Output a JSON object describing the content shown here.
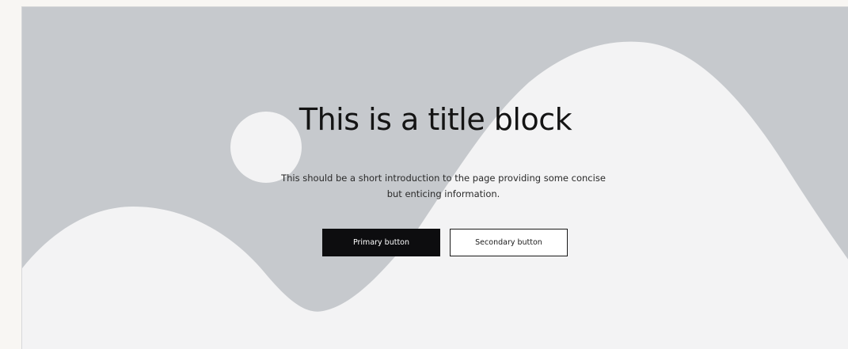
{
  "hero": {
    "title": "This is a title block",
    "intro": "This should be a short introduction to the page providing some concise but enticing information.",
    "primary_button": "Primary button",
    "secondary_button": "Secondary button",
    "colors": {
      "background": "#c6c9cd",
      "shape": "#f3f3f4",
      "primary_button_bg": "#0d0d0f",
      "text": "#141414"
    }
  }
}
